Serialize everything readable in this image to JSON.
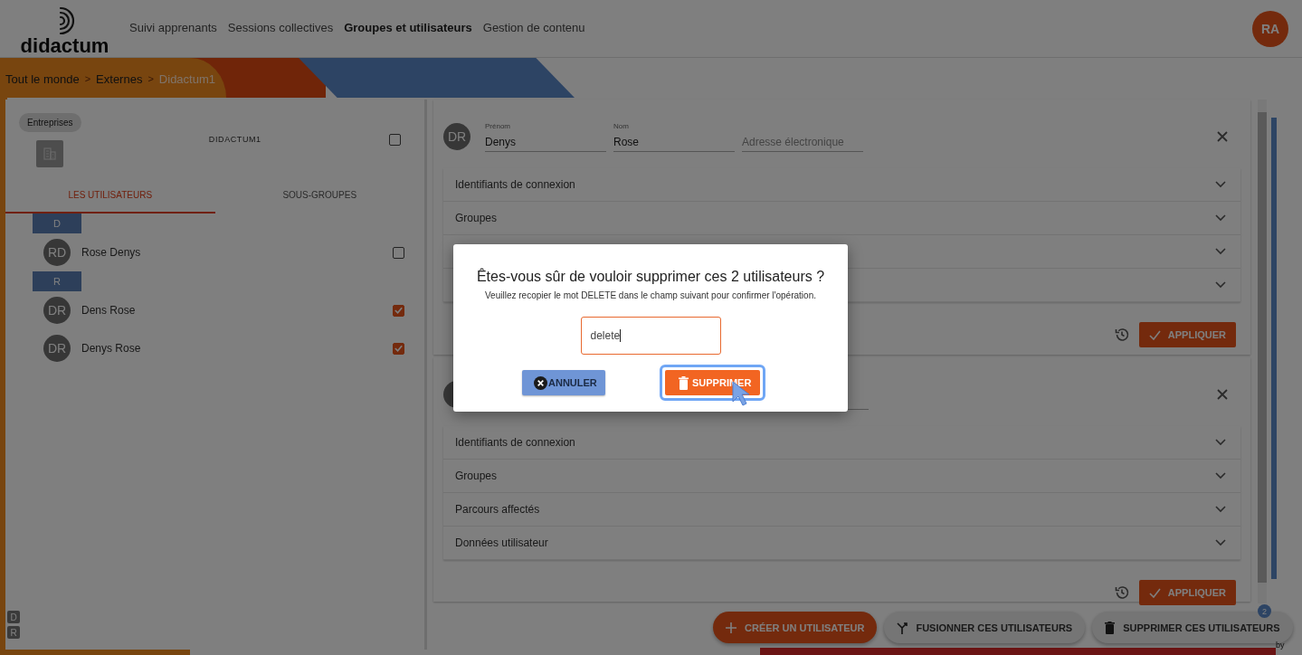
{
  "header": {
    "logo": "didactum",
    "nav": [
      {
        "label": "Suivi apprenants",
        "selected": false
      },
      {
        "label": "Sessions collectives",
        "selected": false
      },
      {
        "label": "Groupes et utilisateurs",
        "selected": true
      },
      {
        "label": "Gestion de contenu",
        "selected": false
      }
    ],
    "avatar": "RA"
  },
  "breadcrumb": {
    "separator": ">",
    "items": [
      {
        "label": "Tout le monde",
        "selected": false
      },
      {
        "label": "Externes",
        "selected": false
      },
      {
        "label": "Didactum1",
        "selected": true
      }
    ]
  },
  "group_panel": {
    "chip": "Entreprises",
    "name": "DIDACTUM1",
    "checked": false,
    "tabs": [
      {
        "label": "LES UTILISATEURS",
        "selected": true
      },
      {
        "label": "SOUS-GROUPES",
        "selected": false
      }
    ],
    "sections": [
      {
        "letter": "D",
        "users": [
          {
            "initials": "RD",
            "name": "Rose Denys",
            "checked": false
          }
        ]
      },
      {
        "letter": "R",
        "users": [
          {
            "initials": "DR",
            "name": "Dens Rose",
            "checked": true
          },
          {
            "initials": "DR",
            "name": "Denys Rose",
            "checked": true
          }
        ]
      }
    ],
    "index": [
      "D",
      "R"
    ]
  },
  "user_cards": [
    {
      "initials": "DR",
      "fields": [
        {
          "label": "Prénom",
          "value": "Denys"
        },
        {
          "label": "Nom",
          "value": "Rose"
        },
        {
          "placeholder": "Adresse électronique"
        }
      ],
      "sections": [
        {
          "label": "Identifiants de connexion",
          "expanded": false
        },
        {
          "label": "Groupes",
          "expanded": false
        },
        {
          "expanded": false
        },
        {
          "expanded": false
        }
      ],
      "apply": "APPLIQUER"
    },
    {
      "sections": [
        {
          "label": "Identifiants de connexion",
          "expanded": false
        },
        {
          "label": "Groupes",
          "expanded": false
        },
        {
          "label": "Parcours affectés",
          "expanded": false
        },
        {
          "label": "Données utilisateur",
          "expanded": false
        }
      ],
      "apply": "APPLIQUER"
    }
  ],
  "actions": [
    {
      "label": "CRÉER UN UTILISATEUR",
      "kind": "create"
    },
    {
      "label": "FUSIONNER CES UTILISATEURS",
      "kind": "merge"
    },
    {
      "label": "SUPPRIMER CES UTILISATEURS",
      "kind": "delete"
    }
  ],
  "selection_count": "2",
  "footer_mark": "by",
  "dialog": {
    "title": "Êtes-vous sûr de vouloir supprimer ces 2 utilisateurs ?",
    "message": "Veuillez recopier le mot DELETE dans le champ suivant pour confirmer l'opération.",
    "input": "delete",
    "cancel": "ANNULER",
    "confirm": "SUPPRIMER"
  }
}
